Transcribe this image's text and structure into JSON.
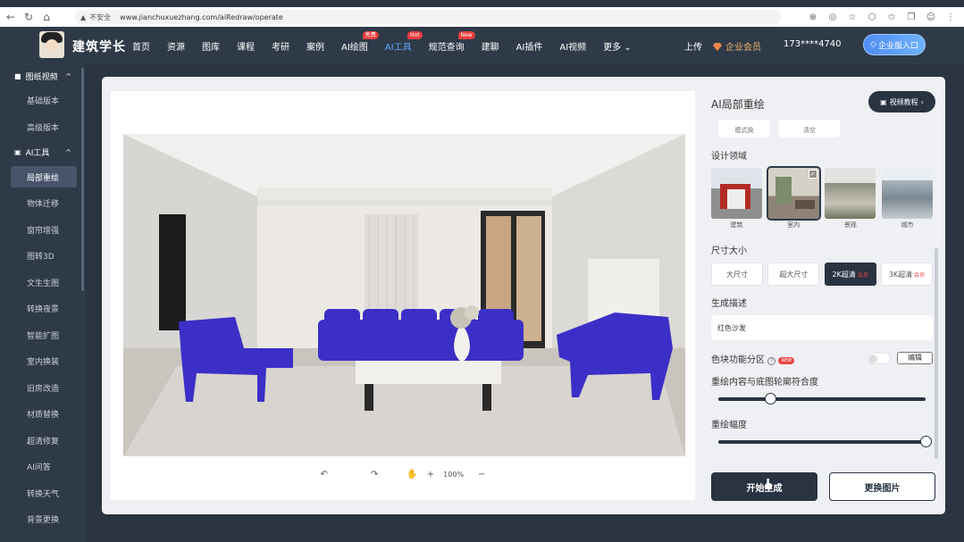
{
  "browser": {
    "insecure_label": "不安全",
    "url": "www.jianchuxuezhang.com/aiRedraw/operate"
  },
  "header": {
    "brand": "建筑学长",
    "nav": [
      {
        "label": "首页"
      },
      {
        "label": "资源"
      },
      {
        "label": "图库"
      },
      {
        "label": "课程"
      },
      {
        "label": "考研"
      },
      {
        "label": "案例"
      },
      {
        "label": "AI绘图",
        "badge": "免费"
      },
      {
        "label": "AI工具",
        "badge": "Hot",
        "active": true
      },
      {
        "label": "规范查询",
        "badge": "New"
      },
      {
        "label": "建聊"
      },
      {
        "label": "AI插件"
      },
      {
        "label": "AI视频"
      },
      {
        "label": "更多"
      }
    ],
    "upload": "上传",
    "vip": "企业会员",
    "phone": "173****4740",
    "enterprise_btn": "企业版入口"
  },
  "sidebar": {
    "section1": "图纸视频",
    "s1_items": [
      "基础版本",
      "高级版本"
    ],
    "section2": "AI工具",
    "s2_items": [
      "局部重绘",
      "物体迁移",
      "窗帘增强",
      "图转3D",
      "文生生图",
      "转换夜景",
      "智能扩图",
      "室内换装",
      "旧房改造",
      "材质替换",
      "超清修复",
      "AI问答",
      "转换天气",
      "背景更换"
    ],
    "active_item": "局部重绘"
  },
  "canvas": {
    "zoom": "100%"
  },
  "panel": {
    "title": "AI局部重绘",
    "tutorial_btn": "视频教程",
    "cut_chips": [
      "模式换",
      "清空"
    ],
    "domain_label": "设计领域",
    "domains": [
      {
        "label": "建筑"
      },
      {
        "label": "室内",
        "selected": true
      },
      {
        "label": "景观"
      },
      {
        "label": "城市"
      }
    ],
    "size_label": "尺寸大小",
    "sizes": [
      {
        "label": "大尺寸"
      },
      {
        "label": "超大尺寸"
      },
      {
        "label": "2K超清",
        "tag": "会员",
        "selected": true
      },
      {
        "label": "3K超清",
        "tag": "会员"
      }
    ],
    "desc_label": "生成描述",
    "desc_value": "红色沙发",
    "color_zone_label": "色块功能分区",
    "new_tag": "NEW",
    "edit_btn": "编辑",
    "fit_label": "重绘内容与底图轮廓符合度",
    "fit_value": 0.25,
    "strength_label": "重绘幅度",
    "strength_value": 1.0,
    "generate_btn": "开始生成",
    "swap_btn": "更换图片"
  }
}
